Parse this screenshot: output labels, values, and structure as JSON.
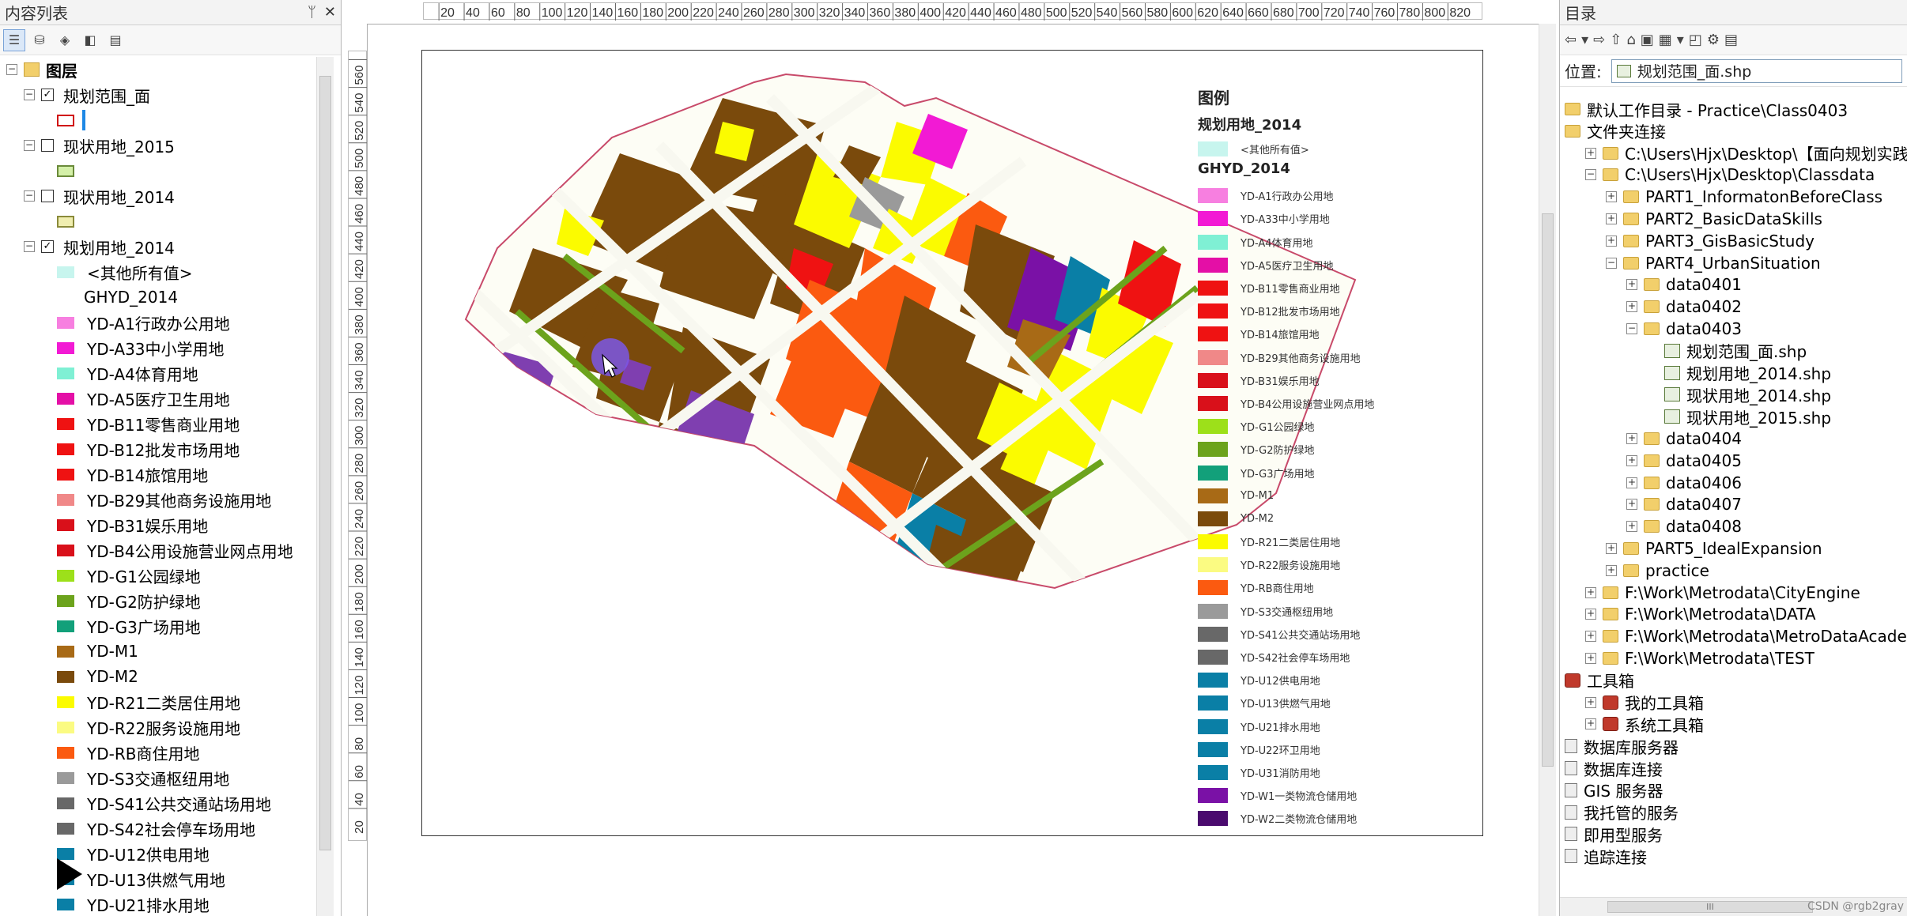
{
  "toc": {
    "title": "内容列表",
    "pin": "ᛘ",
    "close": "✕",
    "root_label": "图层",
    "layers": [
      {
        "name": "规划范围_面",
        "checked": true
      },
      {
        "name": "现状用地_2015",
        "checked": false
      },
      {
        "name": "现状用地_2014",
        "checked": false
      },
      {
        "name": "规划用地_2014",
        "checked": true
      }
    ],
    "other_values": "<其他所有值>",
    "field": "GHYD_2014",
    "classes": [
      {
        "label": "YD-A1行政办公用地",
        "color": "#f77fe0"
      },
      {
        "label": "YD-A33中小学用地",
        "color": "#f21ad4"
      },
      {
        "label": "YD-A4体育用地",
        "color": "#7ff0d4"
      },
      {
        "label": "YD-A5医疗卫生用地",
        "color": "#e40fa6"
      },
      {
        "label": "YD-B11零售商业用地",
        "color": "#ef1212"
      },
      {
        "label": "YD-B12批发市场用地",
        "color": "#ef1212"
      },
      {
        "label": "YD-B14旅馆用地",
        "color": "#ef1212"
      },
      {
        "label": "YD-B29其他商务设施用地",
        "color": "#f08888"
      },
      {
        "label": "YD-B31娱乐用地",
        "color": "#d9101a"
      },
      {
        "label": "YD-B4公用设施营业网点用地",
        "color": "#d9101a"
      },
      {
        "label": "YD-G1公园绿地",
        "color": "#9de01a"
      },
      {
        "label": "YD-G2防护绿地",
        "color": "#6ca31c"
      },
      {
        "label": "YD-G3广场用地",
        "color": "#12a07a"
      },
      {
        "label": "YD-M1",
        "color": "#a86a16"
      },
      {
        "label": "YD-M2",
        "color": "#7a4a0c"
      },
      {
        "label": "YD-R21二类居住用地",
        "color": "#fbfb00"
      },
      {
        "label": "YD-R22服务设施用地",
        "color": "#fbfb82"
      },
      {
        "label": "YD-RB商住用地",
        "color": "#fb5a10"
      },
      {
        "label": "YD-S3交通枢纽用地",
        "color": "#9a9a9a"
      },
      {
        "label": "YD-S41公共交通站场用地",
        "color": "#686868"
      },
      {
        "label": "YD-S42社会停车场用地",
        "color": "#686868"
      },
      {
        "label": "YD-U12供电用地",
        "color": "#0a7fa6"
      },
      {
        "label": "YD-U13供燃气用地",
        "color": "#0a7fa6"
      },
      {
        "label": "YD-U21排水用地",
        "color": "#0a7fa6"
      }
    ]
  },
  "map": {
    "ruler_top": [
      "20",
      "40",
      "60",
      "80",
      "100",
      "120",
      "140",
      "160",
      "180",
      "200",
      "220",
      "240",
      "260",
      "280",
      "300",
      "320",
      "340",
      "360",
      "380",
      "400",
      "420",
      "440",
      "460",
      "480",
      "500",
      "520",
      "540",
      "560",
      "580",
      "600",
      "620",
      "640",
      "660",
      "680",
      "700",
      "720",
      "740",
      "760",
      "780",
      "800",
      "820"
    ],
    "ruler_left": [
      "560",
      "540",
      "520",
      "500",
      "480",
      "460",
      "440",
      "420",
      "400",
      "380",
      "360",
      "340",
      "320",
      "300",
      "280",
      "260",
      "240",
      "220",
      "200",
      "180",
      "160",
      "140",
      "120",
      "100",
      "80",
      "60",
      "40",
      "20"
    ],
    "legend": {
      "title": "图例",
      "layer": "规划用地_2014",
      "other": "<其他所有值>",
      "field": "GHYD_2014",
      "items": [
        {
          "label": "YD-A1行政办公用地",
          "color": "#f77fe0"
        },
        {
          "label": "YD-A33中小学用地",
          "color": "#f21ad4"
        },
        {
          "label": "YD-A4体育用地",
          "color": "#7ff0d4"
        },
        {
          "label": "YD-A5医疗卫生用地",
          "color": "#e40fa6"
        },
        {
          "label": "YD-B11零售商业用地",
          "color": "#ef1212"
        },
        {
          "label": "YD-B12批发市场用地",
          "color": "#ef1212"
        },
        {
          "label": "YD-B14旅馆用地",
          "color": "#ef1212"
        },
        {
          "label": "YD-B29其他商务设施用地",
          "color": "#f08888"
        },
        {
          "label": "YD-B31娱乐用地",
          "color": "#d9101a"
        },
        {
          "label": "YD-B4公用设施营业网点用地",
          "color": "#d9101a"
        },
        {
          "label": "YD-G1公园绿地",
          "color": "#9de01a"
        },
        {
          "label": "YD-G2防护绿地",
          "color": "#6ca31c"
        },
        {
          "label": "YD-G3广场用地",
          "color": "#12a07a"
        },
        {
          "label": "YD-M1",
          "color": "#a86a16"
        },
        {
          "label": "YD-M2",
          "color": "#7a4a0c"
        },
        {
          "label": "YD-R21二类居住用地",
          "color": "#fbfb00"
        },
        {
          "label": "YD-R22服务设施用地",
          "color": "#fbfb82"
        },
        {
          "label": "YD-RB商住用地",
          "color": "#fb5a10"
        },
        {
          "label": "YD-S3交通枢纽用地",
          "color": "#9a9a9a"
        },
        {
          "label": "YD-S41公共交通站场用地",
          "color": "#686868"
        },
        {
          "label": "YD-S42社会停车场用地",
          "color": "#686868"
        },
        {
          "label": "YD-U12供电用地",
          "color": "#0a7fa6"
        },
        {
          "label": "YD-U13供燃气用地",
          "color": "#0a7fa6"
        },
        {
          "label": "YD-U21排水用地",
          "color": "#0a7fa6"
        },
        {
          "label": "YD-U22环卫用地",
          "color": "#0a7fa6"
        },
        {
          "label": "YD-U31消防用地",
          "color": "#0a7fa6"
        },
        {
          "label": "YD-W1一类物流仓储用地",
          "color": "#7a11a6"
        },
        {
          "label": "YD-W2二类物流仓储用地",
          "color": "#4a0a6e"
        }
      ]
    }
  },
  "catalog": {
    "title": "目录",
    "location_label": "位置:",
    "location_value": "规划范围_面.shp",
    "tree": [
      {
        "label": "默认工作目录 - Practice\\Class0403",
        "icon": "home-folder"
      },
      {
        "label": "文件夹连接",
        "icon": "folder"
      },
      {
        "label": "C:\\Users\\Hjx\\Desktop\\【面向规划实践的",
        "icon": "folder",
        "exp": "+"
      },
      {
        "label": "C:\\Users\\Hjx\\Desktop\\Classdata",
        "icon": "folder",
        "exp": "−"
      },
      {
        "label": "PART1_InformatonBeforeClass",
        "icon": "folder",
        "exp": "+"
      },
      {
        "label": "PART2_BasicDataSkills",
        "icon": "folder",
        "exp": "+"
      },
      {
        "label": "PART3_GisBasicStudy",
        "icon": "folder",
        "exp": "+"
      },
      {
        "label": "PART4_UrbanSituation",
        "icon": "folder",
        "exp": "−"
      },
      {
        "label": "data0401",
        "icon": "folder",
        "exp": "+"
      },
      {
        "label": "data0402",
        "icon": "folder",
        "exp": "+"
      },
      {
        "label": "data0403",
        "icon": "folder",
        "exp": "−"
      },
      {
        "label": "规划范围_面.shp",
        "icon": "shapefile"
      },
      {
        "label": "规划用地_2014.shp",
        "icon": "shapefile"
      },
      {
        "label": "现状用地_2014.shp",
        "icon": "shapefile"
      },
      {
        "label": "现状用地_2015.shp",
        "icon": "shapefile"
      },
      {
        "label": "data0404",
        "icon": "folder",
        "exp": "+"
      },
      {
        "label": "data0405",
        "icon": "folder",
        "exp": "+"
      },
      {
        "label": "data0406",
        "icon": "folder",
        "exp": "+"
      },
      {
        "label": "data0407",
        "icon": "folder",
        "exp": "+"
      },
      {
        "label": "data0408",
        "icon": "folder",
        "exp": "+"
      },
      {
        "label": "PART5_IdealExpansion",
        "icon": "folder",
        "exp": "+"
      },
      {
        "label": "practice",
        "icon": "folder",
        "exp": "+"
      },
      {
        "label": "F:\\Work\\Metrodata\\CityEngine",
        "icon": "folder",
        "exp": "+"
      },
      {
        "label": "F:\\Work\\Metrodata\\DATA",
        "icon": "folder",
        "exp": "+"
      },
      {
        "label": "F:\\Work\\Metrodata\\MetroDataAcadem",
        "icon": "folder",
        "exp": "+"
      },
      {
        "label": "F:\\Work\\Metrodata\\TEST",
        "icon": "folder",
        "exp": "+"
      },
      {
        "label": "工具箱",
        "icon": "toolbox"
      },
      {
        "label": "我的工具箱",
        "icon": "toolbox",
        "exp": "+"
      },
      {
        "label": "系统工具箱",
        "icon": "toolbox",
        "exp": "+"
      },
      {
        "label": "数据库服务器",
        "icon": "server"
      },
      {
        "label": "数据库连接",
        "icon": "server"
      },
      {
        "label": "GIS 服务器",
        "icon": "server"
      },
      {
        "label": "我托管的服务",
        "icon": "server"
      },
      {
        "label": "即用型服务",
        "icon": "server"
      },
      {
        "label": "追踪连接",
        "icon": "server"
      }
    ],
    "scroll_label": "III"
  },
  "watermark": "CSDN @rgb2gray"
}
